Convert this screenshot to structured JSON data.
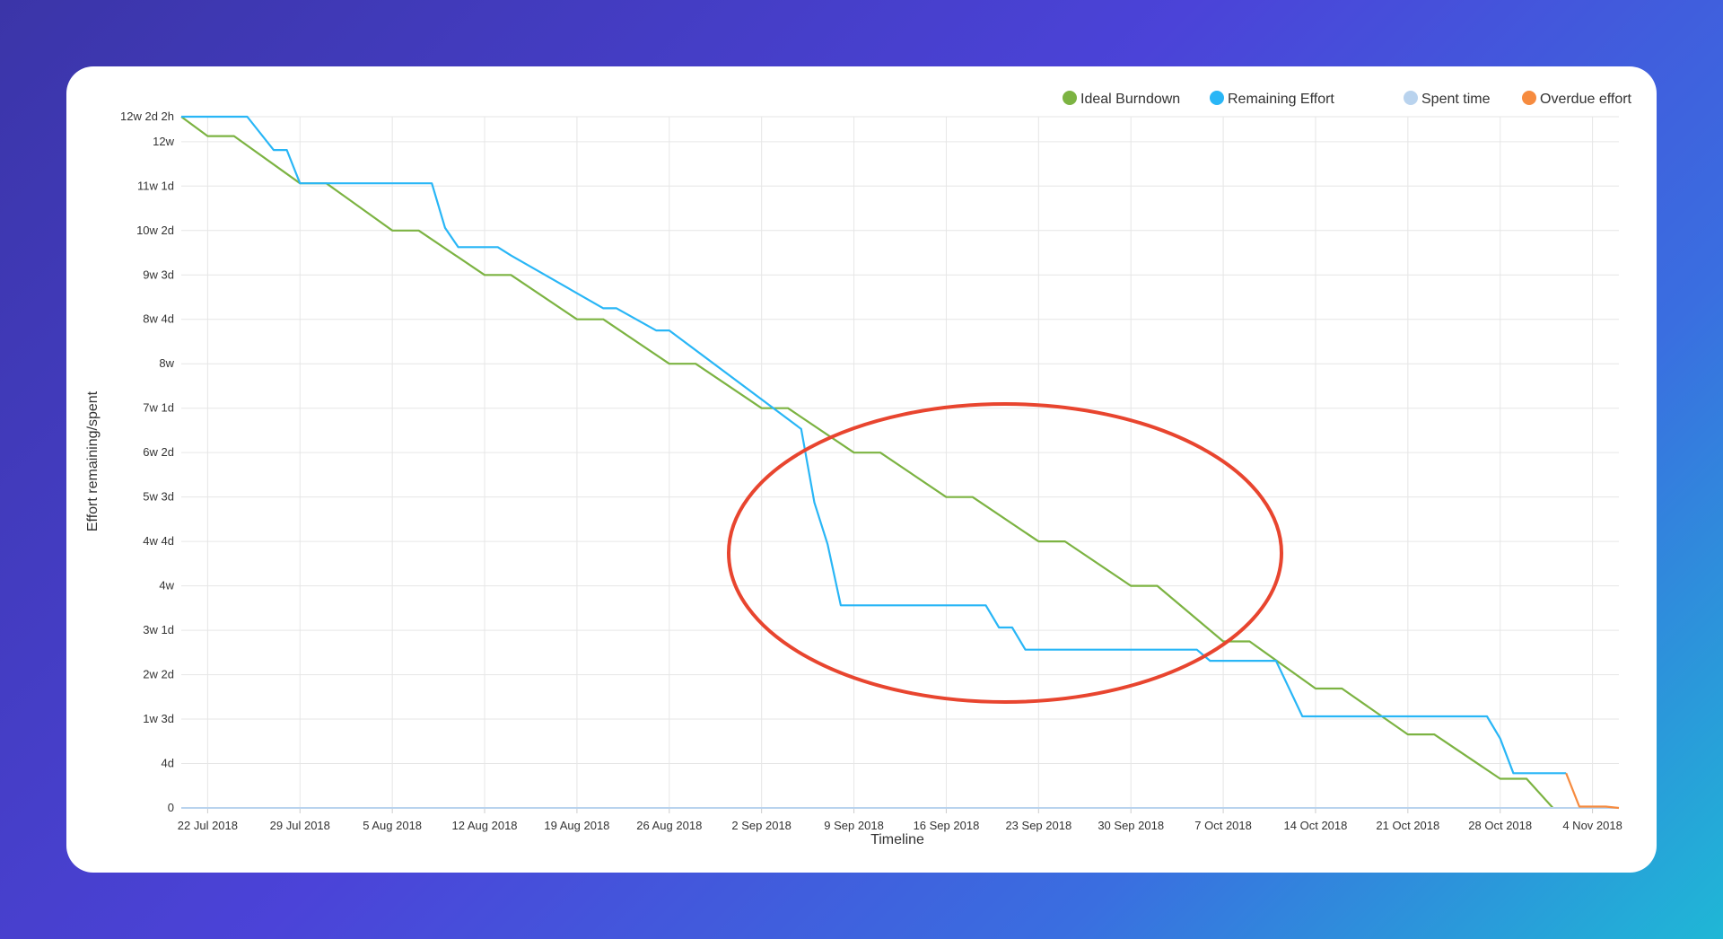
{
  "chart_data": {
    "type": "line",
    "xlabel": "Timeline",
    "ylabel": "Effort remaining/spent",
    "x_ticks": [
      "22 Jul 2018",
      "29 Jul 2018",
      "5 Aug 2018",
      "12 Aug 2018",
      "19 Aug 2018",
      "26 Aug 2018",
      "2 Sep 2018",
      "9 Sep 2018",
      "16 Sep 2018",
      "23 Sep 2018",
      "30 Sep 2018",
      "7 Oct 2018",
      "14 Oct 2018",
      "21 Oct 2018",
      "28 Oct 2018",
      "4 Nov 2018"
    ],
    "x_tick_days": [
      2,
      9,
      16,
      23,
      30,
      37,
      44,
      51,
      58,
      65,
      72,
      79,
      86,
      93,
      100,
      107
    ],
    "y_ticks": [
      {
        "label": "0",
        "h": 0
      },
      {
        "label": "4d",
        "h": 32
      },
      {
        "label": "1w 3d",
        "h": 64
      },
      {
        "label": "2w 2d",
        "h": 96
      },
      {
        "label": "3w 1d",
        "h": 128
      },
      {
        "label": "4w",
        "h": 160
      },
      {
        "label": "4w 4d",
        "h": 192
      },
      {
        "label": "5w 3d",
        "h": 224
      },
      {
        "label": "6w 2d",
        "h": 256
      },
      {
        "label": "7w 1d",
        "h": 288
      },
      {
        "label": "8w",
        "h": 320
      },
      {
        "label": "8w 4d",
        "h": 352
      },
      {
        "label": "9w 3d",
        "h": 384
      },
      {
        "label": "10w 2d",
        "h": 416
      },
      {
        "label": "11w 1d",
        "h": 448
      },
      {
        "label": "12w",
        "h": 480
      },
      {
        "label": "12w 2d 2h",
        "h": 498
      }
    ],
    "x_range": [
      0,
      109
    ],
    "y_range": [
      0,
      498
    ],
    "grid": true,
    "legend_position": "top-right",
    "series": [
      {
        "name": "Ideal Burndown",
        "color": "#7cb342",
        "x": [
          0,
          2,
          4,
          9,
          11,
          16,
          18,
          23,
          25,
          30,
          32,
          37,
          39,
          44,
          46,
          51,
          53,
          58,
          60,
          65,
          67,
          72,
          74,
          79,
          81,
          86,
          88,
          93,
          95,
          100,
          102,
          104
        ],
        "y": [
          498,
          484,
          484,
          450,
          450,
          416,
          416,
          384,
          384,
          352,
          352,
          320,
          320,
          288,
          288,
          256,
          256,
          224,
          224,
          192,
          192,
          160,
          160,
          120,
          120,
          86,
          86,
          53,
          53,
          21,
          21,
          0
        ]
      },
      {
        "name": "Remaining Effort",
        "color": "#29b6f6",
        "x": [
          0,
          5,
          7,
          8,
          9,
          10,
          15,
          19,
          20,
          21,
          24,
          25,
          32,
          33,
          36,
          37,
          47,
          48,
          49,
          50,
          61,
          62,
          63,
          64,
          77,
          78,
          83,
          84,
          85,
          99,
          100,
          101,
          105
        ],
        "y": [
          498,
          498,
          474,
          474,
          450,
          450,
          450,
          450,
          418,
          404,
          404,
          398,
          360,
          360,
          344,
          344,
          273,
          220,
          190,
          146,
          146,
          130,
          130,
          114,
          114,
          106,
          106,
          86,
          66,
          66,
          50,
          25,
          25
        ]
      },
      {
        "name": "Spent time",
        "color": "#b9d3ee",
        "x": [
          0,
          109
        ],
        "y": [
          0,
          0
        ]
      },
      {
        "name": "Overdue effort",
        "color": "#f68b3f",
        "x": [
          105,
          106,
          108,
          109
        ],
        "y": [
          25,
          1,
          1,
          0
        ]
      }
    ]
  }
}
